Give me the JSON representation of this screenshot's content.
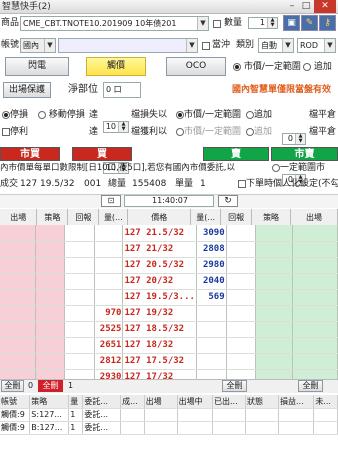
{
  "window": {
    "title": "智慧快手(2)",
    "min": "–",
    "max": "□",
    "close": "✕"
  },
  "row1": {
    "label": "商品",
    "product": "CME_CBT.TNOTE10.201909 10年债201",
    "qty_label": "數量",
    "qty": "1",
    "lock_icon": "🔒",
    "wrench_icon": "🔧",
    "key_icon": "🔑"
  },
  "row2": {
    "label": "帳號",
    "account_prefix": "國內",
    "account": "",
    "reduce_label": "當沖",
    "type_label": "類別",
    "type_value": "自動",
    "mode_value": "ROD"
  },
  "row3": {
    "flash": "閃電",
    "entrust": "觸價",
    "oco": "OCO",
    "opt1": "市價/一定範圍",
    "opt2": "追加"
  },
  "row4": {
    "protect": "出場保護",
    "netpos_label": "淨部位",
    "netpos": "0 口",
    "marquee": "國內智慧單僅限當盤有效"
  },
  "row5": {
    "opt_stop": "停損",
    "opt_trail": "移動停損",
    "reach": "達",
    "val": "10",
    "tick_loss": "檔損失以",
    "opt_mkt": "市價/一定範圍",
    "opt_add": "追加",
    "val2": "0",
    "tick_unit": "檔平倉"
  },
  "row6": {
    "opt_profit": "停利",
    "reach": "達",
    "val": "10",
    "tick_profit": "檔獲利以",
    "opt_mkt": "市價/一定範圍",
    "opt_add": "追加",
    "val2": "0",
    "tick_unit": "檔平倉"
  },
  "trade": {
    "mkt_buy": "市買",
    "buy": "買",
    "sell": "賣",
    "mkt_sell": "市賣"
  },
  "notice": {
    "text": "內市價單每單口數限制[日10口,夜5口],若您有國內市價委託,以",
    "opt": "一定範圍市"
  },
  "quote": {
    "label": "成交",
    "price": "127 19.5/32",
    "tick": "001",
    "vol_label": "總量",
    "vol": "155408",
    "qty_label": "單量",
    "qty": "1",
    "chk_label": "下單時個人化設定(不勾不跳確"
  },
  "center_row": {
    "lock": "🔓",
    "time": "11:40:07",
    "refresh": "↻"
  },
  "headers": [
    "出場",
    "策略",
    "回報",
    "量(...",
    "價格",
    "量(...",
    "回報",
    "策略",
    "出場"
  ],
  "rows": [
    {
      "bidq": "",
      "price": "127 21.5/32",
      "askq": "3090"
    },
    {
      "bidq": "",
      "price": "127 21/32",
      "askq": "2808"
    },
    {
      "bidq": "",
      "price": "127 20.5/32",
      "askq": "2980"
    },
    {
      "bidq": "",
      "price": "127 20/32",
      "askq": "2040"
    },
    {
      "bidq": "",
      "price": "127 19.5/3...",
      "askq": "569"
    },
    {
      "bidq": "970",
      "price": "127 19/32",
      "askq": ""
    },
    {
      "bidq": "2525",
      "price": "127 18.5/32",
      "askq": ""
    },
    {
      "bidq": "2651",
      "price": "127 18/32",
      "askq": ""
    },
    {
      "bidq": "2812",
      "price": "127 17.5/32",
      "askq": ""
    },
    {
      "bidq": "2930",
      "price": "127 17/32",
      "askq": ""
    }
  ],
  "footer": {
    "delete_all_l": "全刪",
    "count_l": "0",
    "delete_all_red": "全刪",
    "count_m": "1",
    "delete_all_r": "全刪",
    "delete_all_rr": "全刪"
  },
  "bottom_headers": [
    "帳號",
    "策略",
    "量",
    "委託...",
    "成...",
    "出場",
    "出場中",
    "已出...",
    "狀態",
    "損益...",
    "未..."
  ],
  "bottom_rows": [
    [
      "觸價:9",
      "S:127...",
      "1",
      "委託..."
    ],
    [
      "觸價:9",
      "B:127...",
      "1",
      "委託..."
    ]
  ],
  "colors": {
    "red": "#c8281e",
    "green": "#12a548",
    "bid_bg": "#f6d0d6",
    "ask_bg": "#cfeed5"
  }
}
